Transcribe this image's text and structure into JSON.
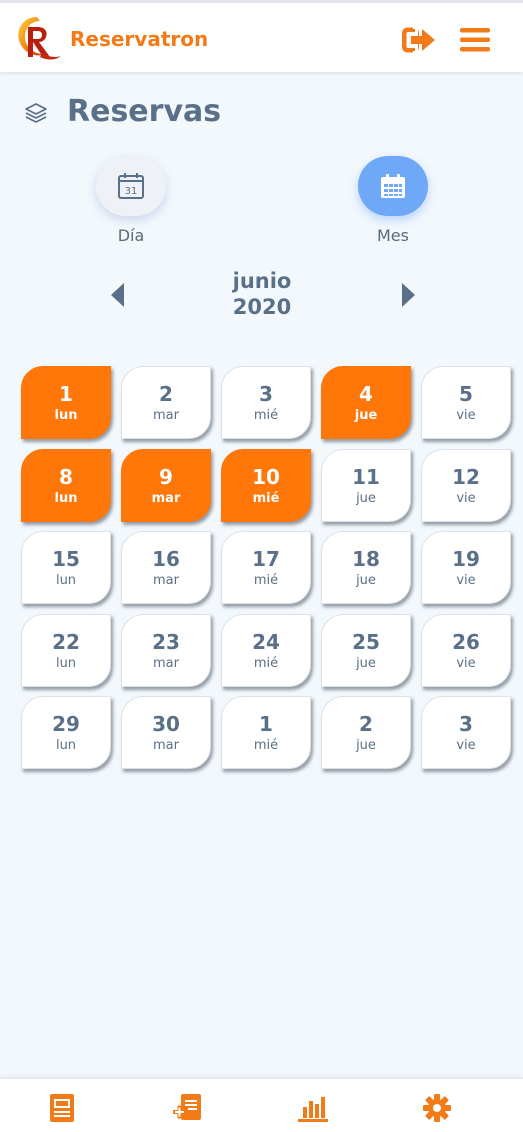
{
  "header": {
    "brand": "Reservatron",
    "logout_icon": "sign-out-icon",
    "menu_icon": "hamburger-menu-icon"
  },
  "page": {
    "title": "Reservas",
    "title_icon": "layers-icon"
  },
  "view_toggle": {
    "day_label": "Día",
    "month_label": "Mes",
    "active": "month"
  },
  "month_nav": {
    "month": "junio",
    "year": "2020"
  },
  "calendar": {
    "days": [
      {
        "num": "1",
        "name": "lun",
        "booked": true
      },
      {
        "num": "2",
        "name": "mar",
        "booked": false
      },
      {
        "num": "3",
        "name": "mié",
        "booked": false
      },
      {
        "num": "4",
        "name": "jue",
        "booked": true
      },
      {
        "num": "5",
        "name": "vie",
        "booked": false
      },
      {
        "num": "8",
        "name": "lun",
        "booked": true
      },
      {
        "num": "9",
        "name": "mar",
        "booked": true
      },
      {
        "num": "10",
        "name": "mié",
        "booked": true
      },
      {
        "num": "11",
        "name": "jue",
        "booked": false
      },
      {
        "num": "12",
        "name": "vie",
        "booked": false
      },
      {
        "num": "15",
        "name": "lun",
        "booked": false
      },
      {
        "num": "16",
        "name": "mar",
        "booked": false
      },
      {
        "num": "17",
        "name": "mié",
        "booked": false
      },
      {
        "num": "18",
        "name": "jue",
        "booked": false
      },
      {
        "num": "19",
        "name": "vie",
        "booked": false
      },
      {
        "num": "22",
        "name": "lun",
        "booked": false
      },
      {
        "num": "23",
        "name": "mar",
        "booked": false
      },
      {
        "num": "24",
        "name": "mié",
        "booked": false
      },
      {
        "num": "25",
        "name": "jue",
        "booked": false
      },
      {
        "num": "26",
        "name": "vie",
        "booked": false
      },
      {
        "num": "29",
        "name": "lun",
        "booked": false
      },
      {
        "num": "30",
        "name": "mar",
        "booked": false
      },
      {
        "num": "1",
        "name": "mié",
        "booked": false
      },
      {
        "num": "2",
        "name": "jue",
        "booked": false
      },
      {
        "num": "3",
        "name": "vie",
        "booked": false
      }
    ]
  },
  "bottom_nav": {
    "items": [
      "reservations-list-icon",
      "add-reservation-icon",
      "stats-chart-icon",
      "settings-gear-icon"
    ]
  },
  "colors": {
    "accent": "#ff7708",
    "brand": "#f27b18",
    "active_view": "#6ea8f7",
    "text": "#5a7088",
    "background": "#f3f8fd"
  }
}
